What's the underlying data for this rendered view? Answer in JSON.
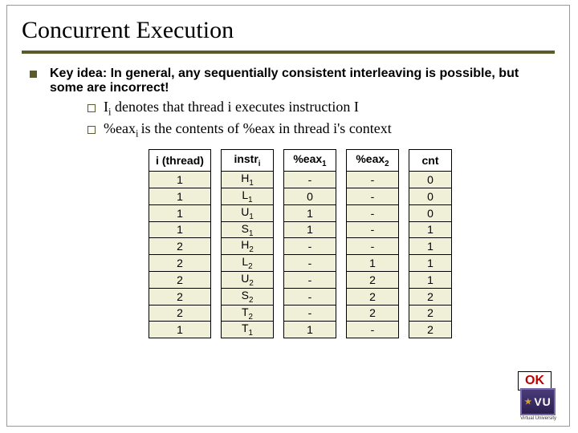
{
  "title": "Concurrent Execution",
  "keyidea": "Key idea: In general, any sequentially consistent interleaving is possible, but some are incorrect!",
  "sub1": {
    "pre": "I",
    "sub": "i",
    "rest": " denotes that thread i executes instruction I"
  },
  "sub2": {
    "pre": "%eax",
    "sub": "i ",
    "rest": "is the contents of %eax in thread i's context"
  },
  "headers": {
    "h0": "i (thread)",
    "h1": {
      "t": "instr",
      "s": "i"
    },
    "h2": {
      "t": "%eax",
      "s": "1"
    },
    "h3": {
      "t": "%eax",
      "s": "2"
    },
    "h4": "cnt"
  },
  "rows": [
    {
      "i": "1",
      "instr": {
        "t": "H",
        "s": "1"
      },
      "e1": "-",
      "e2": "-",
      "cnt": "0"
    },
    {
      "i": "1",
      "instr": {
        "t": "L",
        "s": "1"
      },
      "e1": "0",
      "e2": "-",
      "cnt": "0"
    },
    {
      "i": "1",
      "instr": {
        "t": "U",
        "s": "1"
      },
      "e1": "1",
      "e2": "-",
      "cnt": "0"
    },
    {
      "i": "1",
      "instr": {
        "t": "S",
        "s": "1"
      },
      "e1": "1",
      "e2": "-",
      "cnt": "1"
    },
    {
      "i": "2",
      "instr": {
        "t": "H",
        "s": "2"
      },
      "e1": "-",
      "e2": "-",
      "cnt": "1"
    },
    {
      "i": "2",
      "instr": {
        "t": "L",
        "s": "2"
      },
      "e1": "-",
      "e2": "1",
      "cnt": "1"
    },
    {
      "i": "2",
      "instr": {
        "t": "U",
        "s": "2"
      },
      "e1": "-",
      "e2": "2",
      "cnt": "1"
    },
    {
      "i": "2",
      "instr": {
        "t": "S",
        "s": "2"
      },
      "e1": "-",
      "e2": "2",
      "cnt": "2"
    },
    {
      "i": "2",
      "instr": {
        "t": "T",
        "s": "2"
      },
      "e1": "-",
      "e2": "2",
      "cnt": "2"
    },
    {
      "i": "1",
      "instr": {
        "t": "T",
        "s": "1"
      },
      "e1": "1",
      "e2": "-",
      "cnt": "2"
    }
  ],
  "ok": "OK",
  "logo": {
    "text": "VU",
    "caption": "Virtual University"
  },
  "chart_data": {
    "type": "table",
    "title": "Concurrent Execution trace",
    "columns": [
      "i (thread)",
      "instr_i",
      "%eax_1",
      "%eax_2",
      "cnt"
    ],
    "rows": [
      [
        "1",
        "H1",
        "-",
        "-",
        "0"
      ],
      [
        "1",
        "L1",
        "0",
        "-",
        "0"
      ],
      [
        "1",
        "U1",
        "1",
        "-",
        "0"
      ],
      [
        "1",
        "S1",
        "1",
        "-",
        "1"
      ],
      [
        "2",
        "H2",
        "-",
        "-",
        "1"
      ],
      [
        "2",
        "L2",
        "-",
        "1",
        "1"
      ],
      [
        "2",
        "U2",
        "-",
        "2",
        "1"
      ],
      [
        "2",
        "S2",
        "-",
        "2",
        "2"
      ],
      [
        "2",
        "T2",
        "-",
        "2",
        "2"
      ],
      [
        "1",
        "T1",
        "1",
        "-",
        "2"
      ]
    ]
  }
}
